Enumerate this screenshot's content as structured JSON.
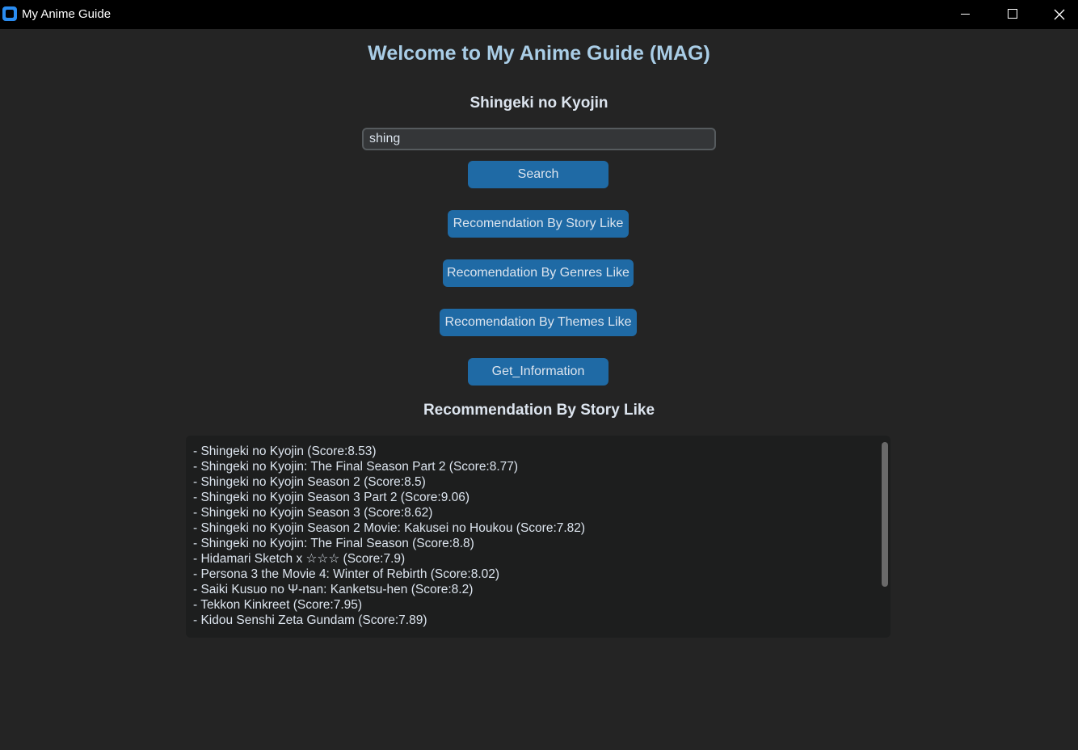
{
  "window": {
    "title": "My Anime Guide"
  },
  "header": {
    "heading": "Welcome to My Anime Guide (MAG)",
    "selected_anime": "Shingeki no Kyojin"
  },
  "search": {
    "value": "shing",
    "placeholder": "",
    "button_label": "Search"
  },
  "actions": {
    "story_label": "Recomendation By Story Like",
    "genres_label": "Recomendation By Genres Like",
    "themes_label": "Recomendation By Themes Like",
    "info_label": "Get_Information"
  },
  "results": {
    "heading": "Recommendation By Story Like",
    "items": [
      "- Shingeki no Kyojin (Score:8.53)",
      "- Shingeki no Kyojin: The Final Season Part 2 (Score:8.77)",
      "- Shingeki no Kyojin Season 2 (Score:8.5)",
      "- Shingeki no Kyojin Season 3 Part 2 (Score:9.06)",
      "- Shingeki no Kyojin Season 3 (Score:8.62)",
      "- Shingeki no Kyojin Season 2 Movie: Kakusei no Houkou (Score:7.82)",
      "- Shingeki no Kyojin: The Final Season (Score:8.8)",
      "- Hidamari Sketch x ☆☆☆ (Score:7.9)",
      "- Persona 3 the Movie 4: Winter of Rebirth (Score:8.02)",
      "- Saiki Kusuo no Ψ-nan: Kanketsu-hen (Score:8.2)",
      "- Tekkon Kinkreet (Score:7.95)",
      "- Kidou Senshi Zeta Gundam (Score:7.89)"
    ]
  },
  "colors": {
    "background": "#242424",
    "titlebar": "#000000",
    "heading": "#a9cde6",
    "text": "#dce4ee",
    "button": "#1f6aa5",
    "input_bg": "#343638",
    "input_border": "#565b5e",
    "textbox_bg": "#1d1e1e",
    "scrollbar": "#6a6a6a"
  },
  "icons": {
    "app": "app-icon",
    "minimize": "minimize-icon",
    "maximize": "maximize-icon",
    "close": "close-icon"
  }
}
